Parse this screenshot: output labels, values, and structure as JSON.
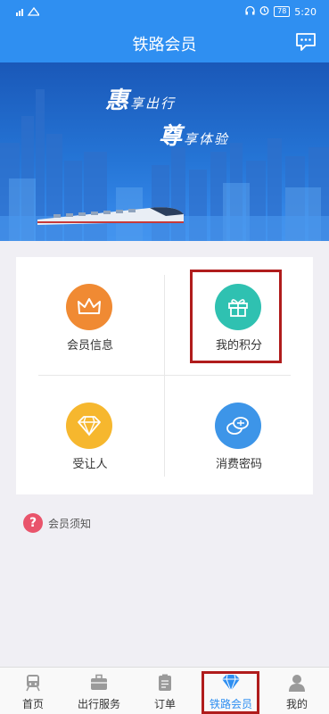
{
  "status_bar": {
    "signal": "ᵃᵃᵃ",
    "battery": "78",
    "time": "5:20"
  },
  "header": {
    "title": "铁路会员"
  },
  "banner": {
    "slogan1_big": "惠",
    "slogan1_rest": "享出行",
    "slogan2_big": "尊",
    "slogan2_rest": "享体验"
  },
  "grid": {
    "items": [
      {
        "label": "会员信息",
        "icon": "crown-icon",
        "color": "#f08a33"
      },
      {
        "label": "我的积分",
        "icon": "gift-icon",
        "color": "#2fc1b1"
      },
      {
        "label": "受让人",
        "icon": "diamond-icon",
        "color": "#f6b72e"
      },
      {
        "label": "消费密码",
        "icon": "coins-icon",
        "color": "#3d95e8"
      }
    ]
  },
  "notice": {
    "icon": "?",
    "label": "会员须知"
  },
  "tabbar": {
    "items": [
      {
        "label": "首页",
        "icon": "train-icon"
      },
      {
        "label": "出行服务",
        "icon": "suitcase-icon"
      },
      {
        "label": "订单",
        "icon": "clipboard-icon"
      },
      {
        "label": "铁路会员",
        "icon": "diamond-icon",
        "active": true
      },
      {
        "label": "我的",
        "icon": "person-icon"
      }
    ]
  },
  "colors": {
    "primary": "#2f8ff1",
    "highlight": "#b01c1c"
  }
}
